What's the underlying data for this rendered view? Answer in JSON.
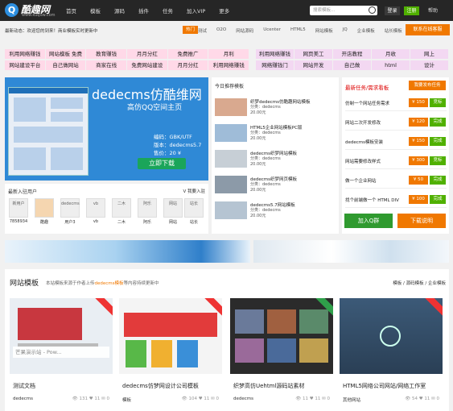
{
  "header": {
    "logo_mark": "Q",
    "logo_name": "酷趣网",
    "logo_url": "www.kuquw.com",
    "nav": [
      "首页",
      "模板",
      "源码",
      "插件",
      "任务",
      "加入VIP",
      "更多"
    ],
    "search_placeholder": "搜索模板...",
    "login": "登录",
    "register": "注册",
    "help": "帮助"
  },
  "crumb": "最新动态：欢迎您的到来！商业模板实时更新中",
  "hot_label": "热门",
  "tags": [
    "测试",
    "O2O",
    "网站源码",
    "Ucenter",
    "HTML5",
    "网站模板",
    "JQ",
    "企业模板",
    "站长模板"
  ],
  "contact": "联系在线客服",
  "pink_rows": [
    [
      "利用网络赚钱",
      "网站模板 免费",
      "教育赚钱",
      "月月分红",
      "免费推广",
      "月利"
    ],
    [
      "网站建设平台",
      "自己做网站",
      "商家在线",
      "免费网站建设",
      "月月分红",
      "利用网络赚钱"
    ]
  ],
  "purple_rows": [
    [
      "利用网络赚钱",
      "网页美工",
      "开店教程",
      "月收",
      "网上"
    ],
    [
      "网络赚钱门",
      "网站开发",
      "自己做",
      "html",
      "设计"
    ]
  ],
  "banner": {
    "title": "dedecms仿酷维网",
    "subtitle": "高仿QQ空间主页",
    "info": [
      "编码：GBK/UTF",
      "版本：dedecms5.7",
      "售价：20 ¥"
    ],
    "download": "立即下载"
  },
  "recent": {
    "heading": "最新入驻用户",
    "more": "V 我要入驻",
    "users": [
      {
        "name": "7858934",
        "thumb": "新用户"
      },
      {
        "name": "酷趣",
        "thumb": ""
      },
      {
        "name": "用户3",
        "thumb": "dedecms"
      },
      {
        "name": "vb",
        "thumb": "vb"
      },
      {
        "name": "二木",
        "thumb": "二木"
      },
      {
        "name": "阿乐",
        "thumb": "阿乐"
      },
      {
        "name": "网站",
        "thumb": "网站"
      },
      {
        "name": "站长",
        "thumb": "站长"
      }
    ]
  },
  "middle": {
    "heading": "今日推荐模板",
    "rows": [
      {
        "title": "织梦dedecms仿酷趣网站模板",
        "cat": "分类：dedecms",
        "price": "20.00元"
      },
      {
        "title": "HTML5企业网站模板PC版",
        "cat": "分类：dedecms",
        "price": "20.00元"
      },
      {
        "title": "dedecms织梦网站模板",
        "cat": "分类：dedecms",
        "price": "20.00元"
      },
      {
        "title": "dedecms织梦网页模板",
        "cat": "分类：dedecms",
        "price": "20.00元"
      },
      {
        "title": "dedecms5.7网站模板",
        "cat": "分类：dedecms",
        "price": "20.00元"
      }
    ]
  },
  "tasks": {
    "heading": "最新任务/需求看板",
    "publish": "我要发布任务",
    "items": [
      {
        "title": "仿制一个网站任务需求",
        "price": "¥ 150",
        "status": "竞标",
        "color": "#50b000"
      },
      {
        "title": "网站二次开发修改",
        "price": "¥ 120",
        "status": "完成",
        "color": "#50b000"
      },
      {
        "title": "dedecms模板安装",
        "price": "¥ 150",
        "status": "完成",
        "color": "#50b000"
      },
      {
        "title": "网站需要修改样式",
        "price": "¥ 300",
        "status": "竞标",
        "color": "#50b000"
      },
      {
        "title": "做一个企业网站",
        "price": "¥ 50",
        "status": "完成",
        "color": "#50b000"
      },
      {
        "title": "找个前端做一个 HTML DIV",
        "price": "¥ 100",
        "status": "完成",
        "color": "#50b000"
      }
    ],
    "qq": "加入Q群",
    "order": "下载说明"
  },
  "gallery": {
    "heading": "网站模板",
    "sub_prefix": "本站模板来源于作者上传",
    "sub_highlight": "dedecms模板",
    "sub_suffix": "等内容持续更新中",
    "links": "模板 / 源码模板 / 企业模板",
    "cards": [
      {
        "caption": "测试文档",
        "author": "dedecms",
        "views": "131",
        "likes": "11",
        "comments": "0",
        "overlay": "芒果演示站 - Pow..."
      },
      {
        "caption": "dedecms仿梦网设计公司模板",
        "author": "模板",
        "views": "104",
        "likes": "11",
        "comments": "0",
        "overlay": ""
      },
      {
        "caption": "织梦高仿Uehtml源码站素材",
        "author": "dedecms",
        "views": "11",
        "likes": "11",
        "comments": "0",
        "overlay": ""
      },
      {
        "caption": "HTML5网络公司网站/网络工作室",
        "author": "其他网站",
        "views": "54",
        "likes": "11",
        "comments": "0",
        "overlay": ""
      }
    ]
  }
}
